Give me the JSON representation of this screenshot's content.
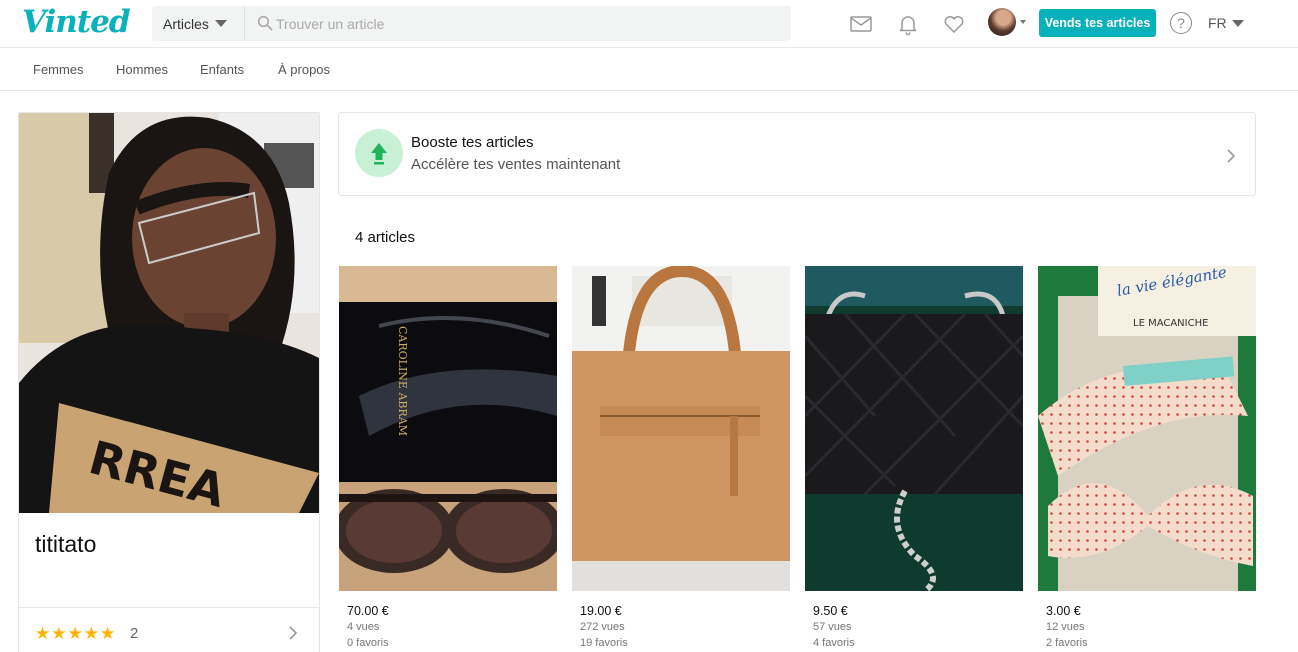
{
  "header": {
    "logo": "Vinted",
    "category_label": "Articles",
    "search_placeholder": "Trouver un article",
    "sell_button": "Vends tes articles",
    "help_label": "?",
    "language": "FR"
  },
  "subnav": [
    "Femmes",
    "Hommes",
    "Enfants",
    "À propos"
  ],
  "profile": {
    "username": "tititato",
    "stars": "★★★★★",
    "review_count": "2"
  },
  "boost": {
    "title": "Booste tes articles",
    "subtitle": "Accélère tes ventes maintenant"
  },
  "article_count": "4 articles",
  "items": [
    {
      "price": "70.00 €",
      "views": "4 vues",
      "favs": "0 favoris"
    },
    {
      "price": "19.00 €",
      "views": "272 vues",
      "favs": "19 favoris"
    },
    {
      "price": "9.50 €",
      "views": "57 vues",
      "favs": "4 favoris"
    },
    {
      "price": "3.00 €",
      "views": "12 vues",
      "favs": "2 favoris"
    }
  ],
  "colors": {
    "brand": "#09b1ba",
    "boost_bg": "#c8f0d5",
    "boost_arrow": "#1fb45a",
    "star": "#ffb400"
  }
}
